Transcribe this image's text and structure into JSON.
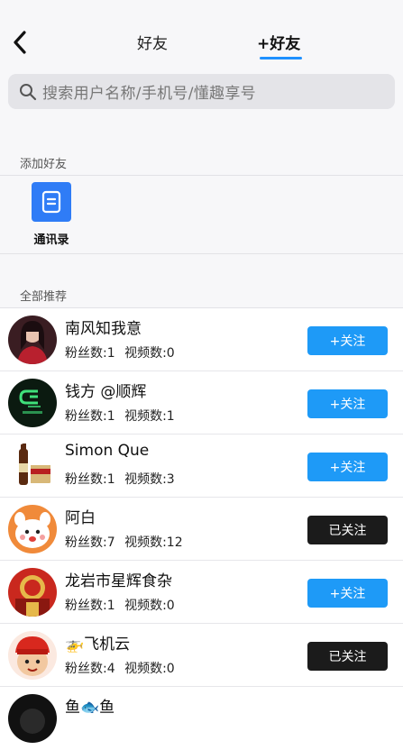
{
  "header": {
    "back_icon": "chevron-left-icon",
    "tabs": [
      {
        "label": "好友",
        "active": false
      },
      {
        "label": "+好友",
        "active": true
      }
    ],
    "accent_color": "#1e90ff"
  },
  "search": {
    "placeholder": "搜索用户名称/手机号/懂趣享号",
    "icon": "search-icon"
  },
  "add_friends": {
    "section_label": "添加好友",
    "contacts": {
      "label": "通讯录",
      "icon": "contacts-book-icon",
      "color": "#2f7cf6"
    }
  },
  "recommend": {
    "section_label": "全部推荐",
    "users": [
      {
        "name": "南风知我意",
        "fans": "粉丝数:1",
        "videos": "视频数:0",
        "button": "+关注",
        "followed": false
      },
      {
        "name": "钱方 @顺辉",
        "fans": "粉丝数:1",
        "videos": "视频数:1",
        "button": "+关注",
        "followed": false
      },
      {
        "name": "Simon Que",
        "fans": "粉丝数:1",
        "videos": "视频数:3",
        "button": "+关注",
        "followed": false
      },
      {
        "name": "阿白",
        "fans": "粉丝数:7",
        "videos": "视频数:12",
        "button": "已关注",
        "followed": true
      },
      {
        "name": "龙岩市星辉食杂",
        "fans": "粉丝数:1",
        "videos": "视频数:0",
        "button": "+关注",
        "followed": false
      },
      {
        "name": "🚁飞机云",
        "fans": "粉丝数:4",
        "videos": "视频数:0",
        "button": "已关注",
        "followed": true
      },
      {
        "name": "鱼🐟鱼",
        "fans": "",
        "videos": "",
        "button": "",
        "followed": false
      }
    ]
  }
}
